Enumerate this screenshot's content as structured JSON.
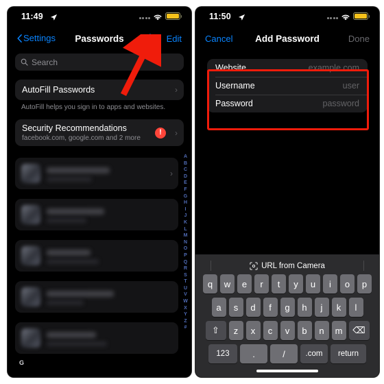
{
  "left_phone": {
    "status_bar": {
      "time": "11:49",
      "location_icon": "location-arrow-icon",
      "signal_icon": "signal-dots-icon",
      "wifi_icon": "wifi-icon",
      "battery_icon": "battery-icon"
    },
    "nav": {
      "back_label": "Settings",
      "title": "Passwords",
      "add_label": "+",
      "edit_label": "Edit"
    },
    "search": {
      "placeholder": "Search",
      "icon": "search-icon"
    },
    "autofill": {
      "title": "AutoFill Passwords",
      "footnote": "AutoFill helps you sign in to apps and websites."
    },
    "security": {
      "title": "Security Recommendations",
      "subtitle": "facebook.com, google.com and 2 more",
      "badge": "!"
    },
    "section_letter": "G",
    "alpha_index": [
      "A",
      "B",
      "C",
      "D",
      "E",
      "F",
      "G",
      "H",
      "I",
      "J",
      "K",
      "L",
      "M",
      "N",
      "O",
      "P",
      "Q",
      "R",
      "S",
      "T",
      "U",
      "V",
      "W",
      "X",
      "Y",
      "Z",
      "#"
    ]
  },
  "right_phone": {
    "status_bar": {
      "time": "11:50",
      "location_icon": "location-arrow-icon",
      "signal_icon": "signal-dots-icon",
      "wifi_icon": "wifi-icon",
      "battery_icon": "battery-icon"
    },
    "nav": {
      "cancel_label": "Cancel",
      "title": "Add Password",
      "done_label": "Done"
    },
    "form": [
      {
        "label": "Website",
        "value": "example.com"
      },
      {
        "label": "Username",
        "value": "user"
      },
      {
        "label": "Password",
        "value": "password"
      }
    ],
    "keyboard": {
      "suggestion": "URL from Camera",
      "suggestion_icon": "camera-scan-icon",
      "row1": [
        "q",
        "w",
        "e",
        "r",
        "t",
        "y",
        "u",
        "i",
        "o",
        "p"
      ],
      "row2": [
        "a",
        "s",
        "d",
        "f",
        "g",
        "h",
        "j",
        "k",
        "l"
      ],
      "row3": [
        "z",
        "x",
        "c",
        "v",
        "b",
        "n",
        "m"
      ],
      "shift_label": "⇧",
      "backspace_label": "⌫",
      "numbers_label": "123",
      "period_label": ".",
      "slash_label": "/",
      "dotcom_label": ".com",
      "return_label": "return"
    }
  },
  "annotations": {
    "arrow_color": "#f01c0b",
    "box_color": "#f01c0b",
    "arrow_target": "add-password-plus-button",
    "box_target": "add-password-form-card"
  }
}
